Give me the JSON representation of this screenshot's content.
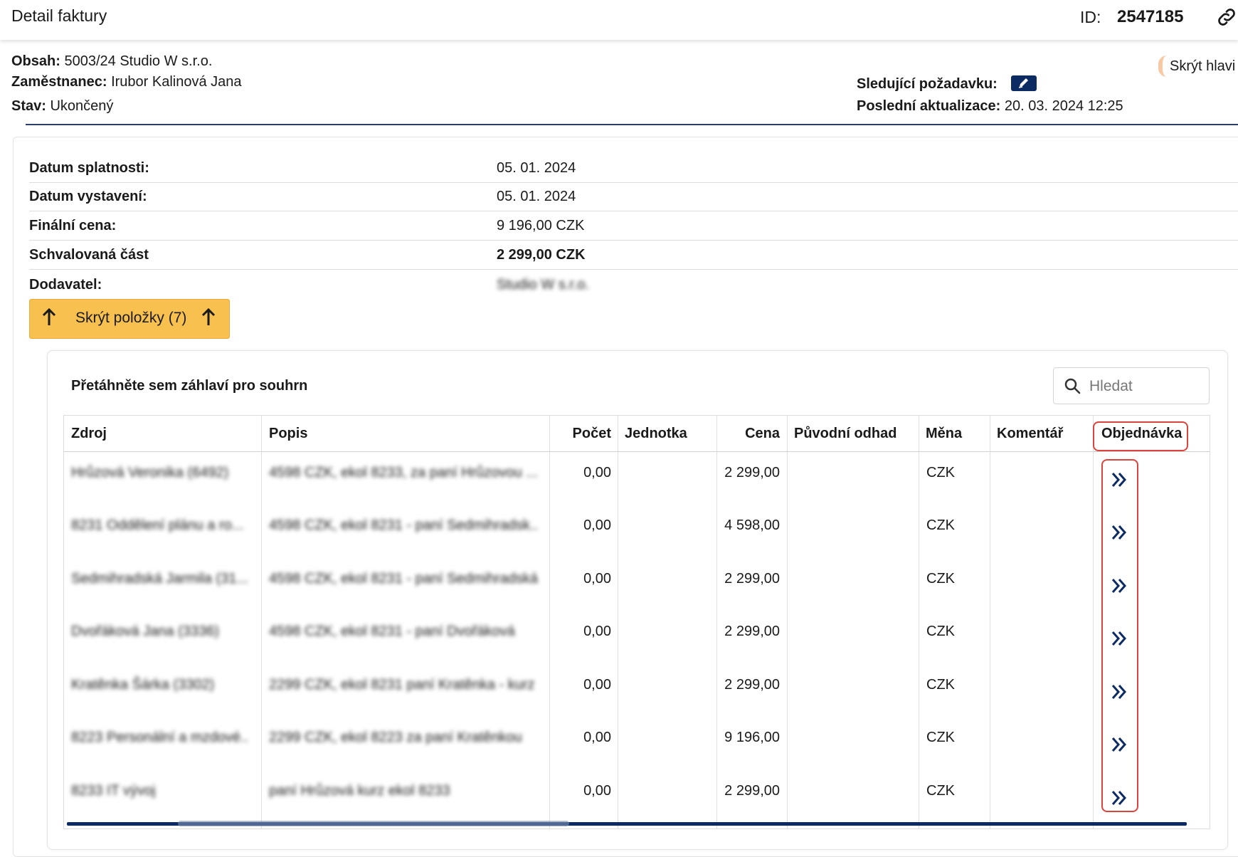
{
  "header": {
    "title": "Detail faktury",
    "id_label": "ID:",
    "id_value": "2547185"
  },
  "info": {
    "obsah_label": "Obsah:",
    "obsah_value": "5003/24 Studio W s.r.o.",
    "zamestnanec_label": "Zaměstnanec:",
    "zamestnanec_value": "Irubor Kalinová Jana",
    "stav_label": "Stav:",
    "stav_value": "Ukončený",
    "sledujici_label": "Sledující požadavku:",
    "posledni_label": "Poslední aktualizace:",
    "posledni_value": "20. 03. 2024 12:25",
    "hide_header_label": "Skrýt hlavi"
  },
  "details": {
    "datum_splatnosti_label": "Datum splatnosti:",
    "datum_splatnosti_value": "05. 01. 2024",
    "datum_vystaveni_label": "Datum vystavení:",
    "datum_vystaveni_value": "05. 01. 2024",
    "financni_cena_label": "Finální cena:",
    "financni_cena_value": "9 196,00 CZK",
    "schvalovana_label": "Schvalovaná část",
    "schvalovana_value": "2 299,00  CZK",
    "dodavatel_label": "Dodavatel:",
    "dodavatel_value": "Studio W s.r.o."
  },
  "items_toggle_label": "Skrýt položky (7)",
  "grid": {
    "group_hint": "Přetáhněte sem záhlaví pro souhrn",
    "search_placeholder": "Hledat",
    "columns": {
      "zdroj": "Zdroj",
      "popis": "Popis",
      "pocet": "Počet",
      "jednotka": "Jednotka",
      "cena": "Cena",
      "puvodni_odhad": "Původní odhad",
      "mena": "Měna",
      "komentar": "Komentář",
      "objednavka": "Objednávka"
    },
    "rows": [
      {
        "zdroj": "Hrůzová Veronika (6492)",
        "popis": "4598 CZK, ekol 8233, za paní Hrůzovou ...",
        "pocet": "0,00",
        "cena": "2 299,00",
        "mena": "CZK"
      },
      {
        "zdroj": "8231 Oddělení plánu a ro...",
        "popis": "4598 CZK, ekol 8231 - paní Sedmihradsk...",
        "pocet": "0,00",
        "cena": "4 598,00",
        "mena": "CZK"
      },
      {
        "zdroj": "Sedmihradská Jarmila (31...",
        "popis": "4598 CZK, ekol 8231 - paní Sedmihradská",
        "pocet": "0,00",
        "cena": "2 299,00",
        "mena": "CZK"
      },
      {
        "zdroj": "Dvořáková Jana (3336)",
        "popis": "4598 CZK, ekol 8231 - paní Dvořáková",
        "pocet": "0,00",
        "cena": "2 299,00",
        "mena": "CZK"
      },
      {
        "zdroj": "Kratěnka Šárka (3302)",
        "popis": "2299 CZK, ekol 8231 paní Kratěnka - kurz",
        "pocet": "0,00",
        "cena": "2 299,00",
        "mena": "CZK"
      },
      {
        "zdroj": "8223 Personální a mzdové...",
        "popis": "2299 CZK, ekol 8223 za paní Kratěnkou",
        "pocet": "0,00",
        "cena": "9 196,00",
        "mena": "CZK"
      },
      {
        "zdroj": "8233 IT vývoj",
        "popis": "paní Hrůzová kurz ekol 8233",
        "pocet": "0,00",
        "cena": "2 299,00",
        "mena": "CZK"
      }
    ]
  }
}
